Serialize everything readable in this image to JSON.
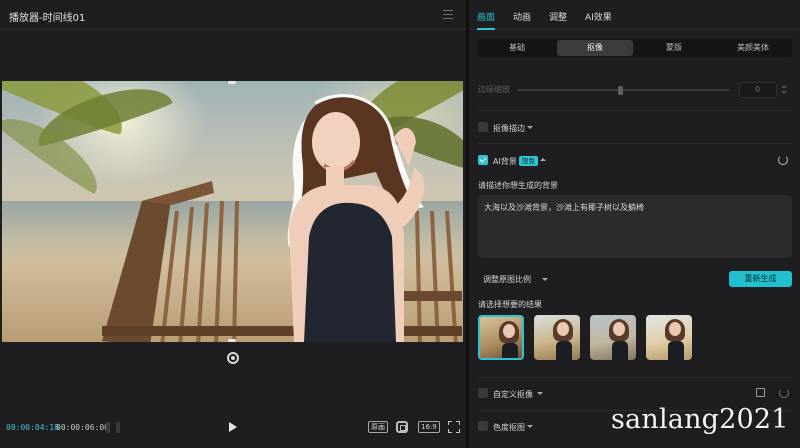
{
  "player": {
    "title": "播放器-时间线01",
    "time_current": "00:00:04:18",
    "time_total": "00:00:06:00",
    "original_label": "原画",
    "ratio_label": "16:9"
  },
  "panel": {
    "top_tabs": [
      "画面",
      "动画",
      "调整",
      "AI效果"
    ],
    "sub_tabs": [
      "基础",
      "抠像",
      "蒙版",
      "美颜美体"
    ],
    "active_sub_tab": "抠像",
    "edge_scale_label": "边缘缩放",
    "edge_scale_value": "0",
    "cutout_stroke_label": "抠像描边",
    "ai_bg_label": "AI背景",
    "ai_bg_badge": "限免",
    "prompt_label": "请描述你想生成的背景",
    "prompt_value": "大海以及沙滩背景，沙滩上有椰子树以及躺椅",
    "adjust_ratio_label": "调整原图比例",
    "regenerate_label": "重新生成",
    "pick_result_label": "请选择想要的结果",
    "custom_cutout_label": "自定义抠像",
    "chroma_key_label": "色度抠图"
  },
  "watermark": "sanlang2021",
  "colors": {
    "accent": "#2fc3d2",
    "panel_bg": "#1e1e20",
    "app_bg": "#0f0f10"
  },
  "icons": {
    "menu": "hamburger-icon",
    "rotate": "rotate-icon",
    "play": "play-icon",
    "frame": "frame-icon",
    "fullscreen": "fullscreen-icon",
    "reset": "reset-icon",
    "edit": "edit-icon"
  }
}
